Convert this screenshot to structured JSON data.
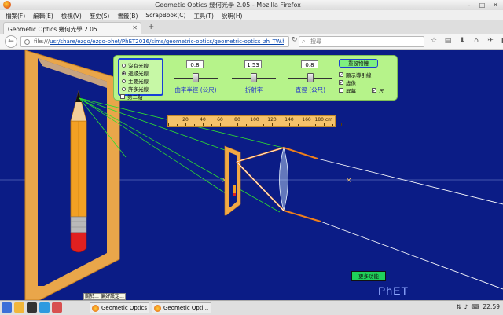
{
  "window": {
    "title": "Geometic Optics 幾何光學 2.05 - Mozilla Firefox",
    "minimize": "–",
    "maximize": "□",
    "close": "✕"
  },
  "menu": [
    "檔案(F)",
    "編輯(E)",
    "檢視(V)",
    "歷史(S)",
    "書籤(B)",
    "ScrapBook(C)",
    "工具(T)",
    "說明(H)"
  ],
  "tab": {
    "label": "Geometic Optics 幾何光學 2.05",
    "close": "✕",
    "new": "+"
  },
  "nav": {
    "url_prefix": "file:///",
    "url_path": "usr/share/ezgo/ezgo-phet/PhET2016/sims/geometric-optics/geometric-optics_zh_TW.html",
    "search_placeholder": "搜尋",
    "back": "←",
    "reload": "↻"
  },
  "controls": {
    "ray_options": [
      "沒有光線",
      "邊緣光線",
      "主要光線",
      "許多光線"
    ],
    "ray_selected_index": 1,
    "second_point_label": "第二點",
    "sliders": [
      {
        "label": "曲率半徑 (公尺)",
        "value": "0.8",
        "level": 0.5
      },
      {
        "label": "折射率",
        "value": "1.53",
        "level": 0.5
      },
      {
        "label": "直徑 (公尺)",
        "value": "0.8",
        "level": 0.5
      }
    ],
    "reset_label": "重設物體",
    "checkboxes": [
      {
        "label": "顯示導引線",
        "checked": true
      },
      {
        "label": "虛像",
        "checked": true
      },
      {
        "label": "屏幕",
        "checked": false
      },
      {
        "label": "尺",
        "checked": true
      }
    ]
  },
  "ruler": {
    "ticks": [
      20,
      40,
      60,
      80,
      100,
      120,
      140,
      160
    ],
    "unit": "180 cm"
  },
  "more_button": "更多功能",
  "brand": "PhET",
  "taskbar": {
    "items": [
      "Geometic Optics",
      "Geometic Opti..."
    ],
    "popup": [
      "關於...",
      "偏好設定..."
    ],
    "clock": "22:59"
  },
  "colors": {
    "sim_background": "#0b1c86",
    "control_panel": "#b6f38a",
    "ray": "#f07f1a",
    "guide_line": "#2ee02e",
    "lens": "#cfe9ff"
  }
}
